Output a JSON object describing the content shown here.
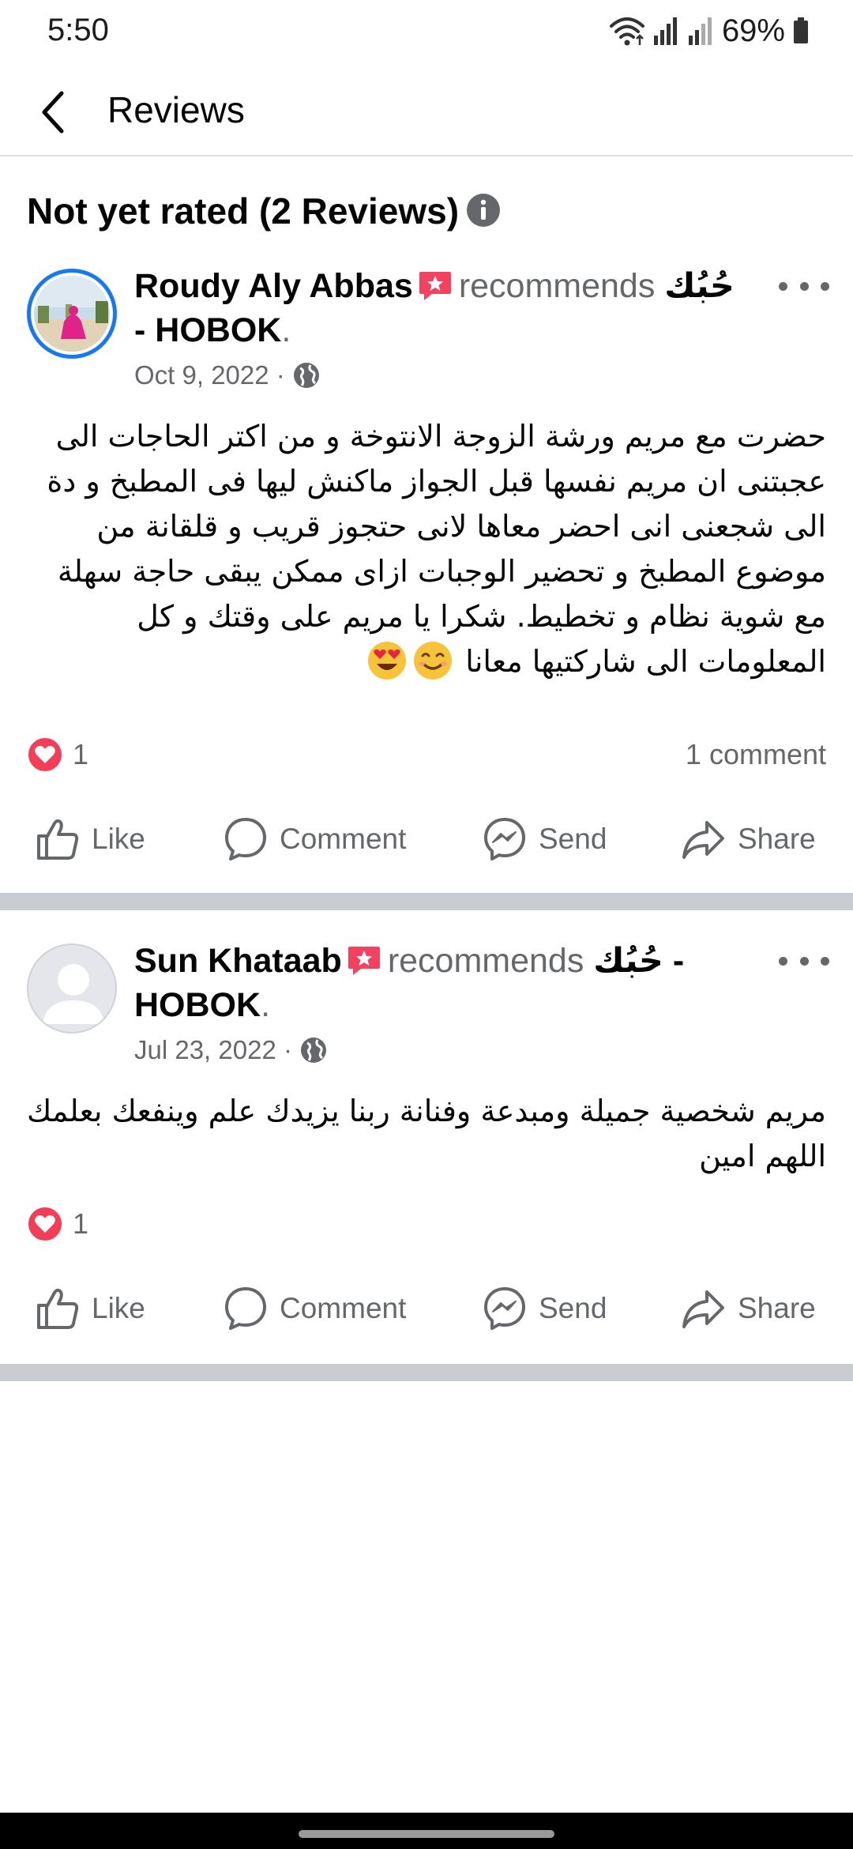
{
  "status_bar": {
    "time": "5:50",
    "battery": "69%"
  },
  "header": {
    "title": "Reviews"
  },
  "section": {
    "title": "Not yet rated (2 Reviews)"
  },
  "reviews": [
    {
      "name": "Roudy Aly Abbas",
      "recommends": "recommends",
      "page": "حُبُك - HOBOK",
      "date": "Oct 9, 2022 ·",
      "text": "حضرت مع مريم ورشة الزوجة الانتوخة و من اكتر الحاجات الى عجبتنى ان مريم نفسها قبل الجواز ماكنش ليها فى المطبخ و دة الى شجعنى انى احضر معاها لانى حتجوز قريب و قلقانة من موضوع المطبخ و تحضير الوجبات ازاى ممكن يبقى حاجة سهلة مع شوية نظام و تخطيط. شكرا يا مريم على وقتك و كل المعلومات الى شاركتيها معانا",
      "reaction_count": "1",
      "comment_count": "1 comment"
    },
    {
      "name": "Sun Khataab",
      "recommends": "recommends",
      "page": "حُبُك - HOBOK",
      "date": "Jul 23, 2022 ·",
      "text": "مريم شخصية جميلة ومبدعة وفنانة ربنا  يزيدك علم وينفعك بعلمك اللهم امين",
      "reaction_count": "1"
    }
  ],
  "actions": {
    "like": "Like",
    "comment": "Comment",
    "send": "Send",
    "share": "Share"
  },
  "colors": {
    "accent": "#1877f2",
    "secondary_text": "#65676b",
    "separator": "#c9ccd1",
    "reaction_red": "#f33e58"
  }
}
